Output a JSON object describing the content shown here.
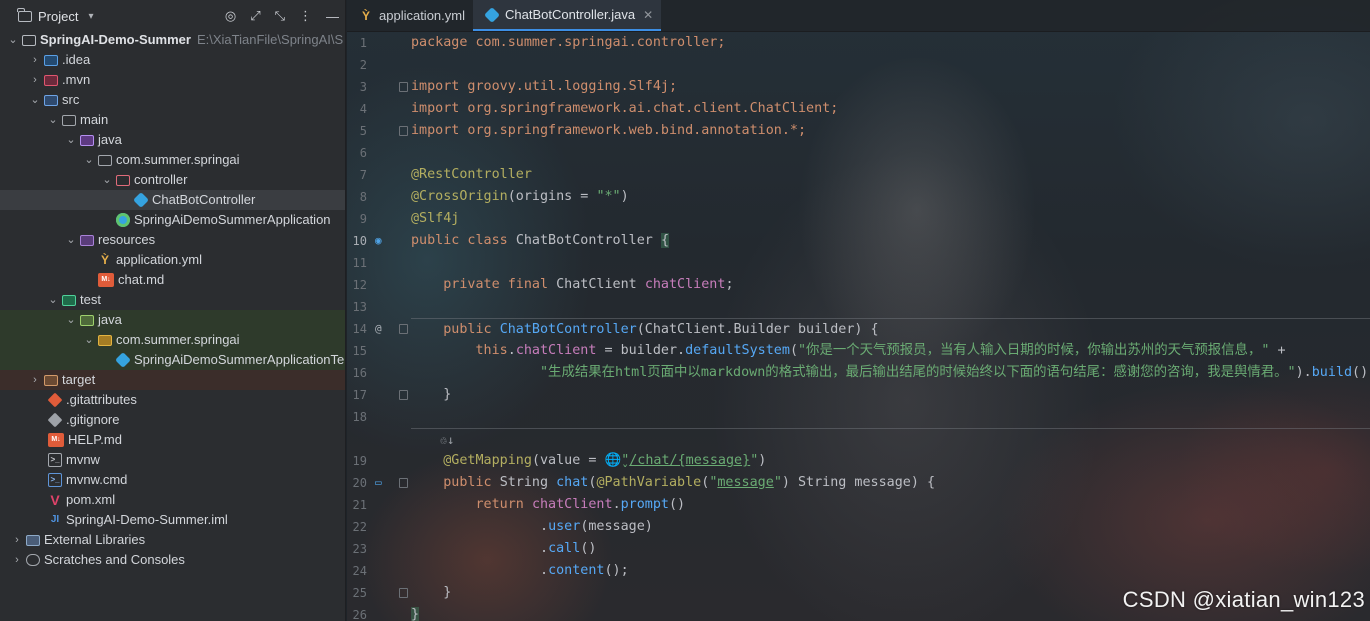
{
  "project_panel": {
    "title": "Project",
    "tools": [
      "target-icon",
      "expand-icon",
      "collapse-icon",
      "more-icon",
      "minimize-icon"
    ],
    "tree": [
      {
        "label": "SpringAI-Demo-Summer",
        "extra": "E:\\XiaTianFile\\SpringAI\\S",
        "icon": "module-folder-icon"
      },
      {
        "label": ".idea",
        "icon": "idea-folder-icon"
      },
      {
        "label": ".mvn",
        "icon": "mvn-folder-icon"
      },
      {
        "label": "src",
        "icon": "source-folder-icon"
      },
      {
        "label": "main",
        "icon": "folder-icon"
      },
      {
        "label": "java",
        "icon": "java-source-folder-icon"
      },
      {
        "label": "com.summer.springai",
        "icon": "package-icon"
      },
      {
        "label": "controller",
        "icon": "package-icon"
      },
      {
        "label": "ChatBotController",
        "icon": "class-icon"
      },
      {
        "label": "SpringAiDemoSummerApplication",
        "icon": "spring-boot-class-icon"
      },
      {
        "label": "resources",
        "icon": "resources-folder-icon"
      },
      {
        "label": "application.yml",
        "icon": "yaml-file-icon"
      },
      {
        "label": "chat.md",
        "icon": "markdown-file-icon"
      },
      {
        "label": "test",
        "icon": "test-folder-icon"
      },
      {
        "label": "java",
        "icon": "java-test-folder-icon"
      },
      {
        "label": "com.summer.springai",
        "icon": "package-icon"
      },
      {
        "label": "SpringAiDemoSummerApplicationTe",
        "icon": "class-icon"
      },
      {
        "label": "target",
        "icon": "excluded-folder-icon"
      },
      {
        "label": ".gitattributes",
        "icon": "git-file-icon"
      },
      {
        "label": ".gitignore",
        "icon": "git-file-icon"
      },
      {
        "label": "HELP.md",
        "icon": "markdown-file-icon"
      },
      {
        "label": "mvnw",
        "icon": "shell-file-icon"
      },
      {
        "label": "mvnw.cmd",
        "icon": "cmd-file-icon"
      },
      {
        "label": "pom.xml",
        "icon": "maven-file-icon"
      },
      {
        "label": "SpringAI-Demo-Summer.iml",
        "icon": "iml-file-icon"
      },
      {
        "label": "External Libraries",
        "icon": "library-icon"
      },
      {
        "label": "Scratches and Consoles",
        "icon": "scratch-icon"
      }
    ]
  },
  "tabs": [
    {
      "label": "application.yml",
      "icon": "yaml-file-icon",
      "active": false
    },
    {
      "label": "ChatBotController.java",
      "icon": "class-icon",
      "active": true
    }
  ],
  "gutter": {
    "line_numbers": [
      "1",
      "2",
      "3",
      "4",
      "5",
      "6",
      "7",
      "8",
      "9",
      "10",
      "11",
      "12",
      "13",
      "14",
      "15",
      "16",
      "17",
      "18",
      "",
      "19",
      "20",
      "21",
      "22",
      "23",
      "24",
      "25",
      "26"
    ]
  },
  "code": {
    "l1": [
      "package com.summer.springai.controller;"
    ],
    "l3": [
      "import groovy.util.logging.Slf4j;"
    ],
    "l4": [
      "import org.springframework.ai.chat.client.ChatClient;"
    ],
    "l5": [
      "import org.springframework.web.bind.annotation.*;"
    ],
    "l7": "@RestController",
    "l8a": "@CrossOrigin",
    "l8b": "(origins = ",
    "l8c": "\"*\"",
    "l8d": ")",
    "l9": "@Slf4j",
    "l10a": "public class ",
    "l10b": "ChatBotController ",
    "l10c": "{",
    "l12a": "    private final ",
    "l12b": "ChatClient ",
    "l12c": "chatClient",
    "l12d": ";",
    "l14a": "    public ",
    "l14b": "ChatBotController",
    "l14c": "(ChatClient.Builder builder) {",
    "l15a": "        this",
    "l15b": ".",
    "l15c": "chatClient",
    "l15d": " = builder.",
    "l15e": "defaultSystem",
    "l15f": "(",
    "l15g": "\"你是一个天气预报员，当有人输入日期的时候，你输出苏州的天气预报信息，\"",
    "l15h": " +",
    "l16a": "                \"生成结果在html页面中以markdown的格式输出，最后输出结尾的时候始终以下面的语句结尾：感谢您的咨询，我是舆情君。\"",
    "l16b": ").",
    "l16c": "build",
    "l16d": "();",
    "l17": "    }",
    "hint": "    ♲↓",
    "l19a": "    @GetMapping",
    "l19b": "(value = ",
    "l19c": "\"",
    "l19d": "/chat/{message}",
    "l19e": "\"",
    "l19f": ")",
    "l20a": "    public ",
    "l20b": "String ",
    "l20c": "chat",
    "l20d": "(",
    "l20e": "@PathVariable",
    "l20f": "(",
    "l20g": "\"",
    "l20h": "message",
    "l20i": "\"",
    "l20j": ") String message) {",
    "l21a": "        return ",
    "l21b": "chatClient",
    "l21c": ".",
    "l21d": "prompt",
    "l21e": "()",
    "l22a": "                .",
    "l22b": "user",
    "l22c": "(message)",
    "l23a": "                .",
    "l23b": "call",
    "l23c": "()",
    "l24a": "                .",
    "l24b": "content",
    "l24c": "();",
    "l25": "    }",
    "l26": "}"
  },
  "watermark": "CSDN @xiatian_win123"
}
